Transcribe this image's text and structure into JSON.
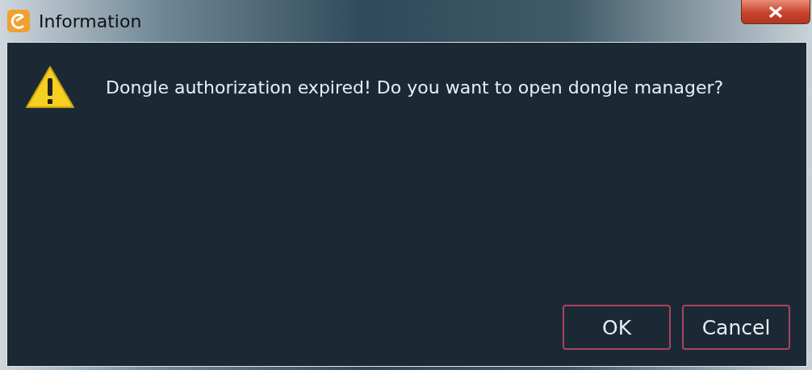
{
  "window": {
    "title": "Information"
  },
  "message": "Dongle authorization expired! Do you want to open dongle manager?",
  "buttons": [
    {
      "label": "OK"
    },
    {
      "label": "Cancel"
    }
  ]
}
